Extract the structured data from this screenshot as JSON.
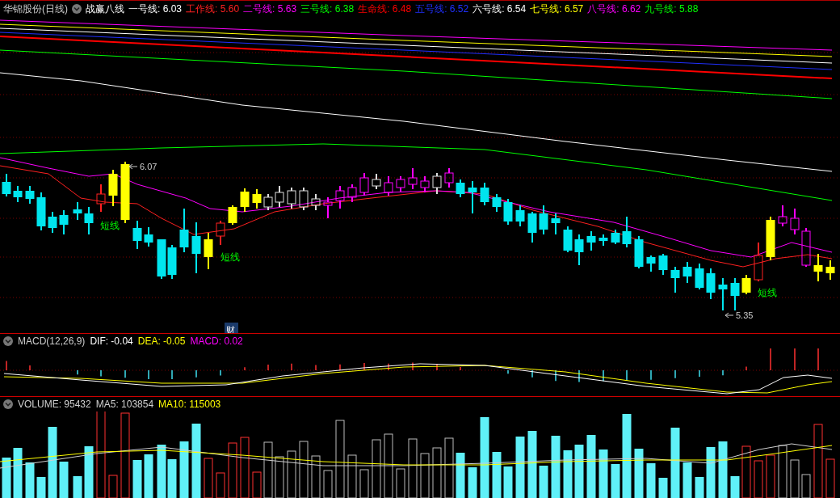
{
  "chart": {
    "title": "华锦股份(日线)",
    "indicator": "战赢八线",
    "lines": [
      {
        "text": "一号线: 6.03",
        "color": "#ffffff"
      },
      {
        "text": "工作线: 5.60",
        "color": "#ff2020"
      },
      {
        "text": "二号线: 5.63",
        "color": "#ff00ff"
      },
      {
        "text": "三号线: 6.38",
        "color": "#00ff00"
      },
      {
        "text": "生命线: 6.48",
        "color": "#ff0000"
      },
      {
        "text": "五号线: 6.52",
        "color": "#2030ff"
      },
      {
        "text": "六号线: 6.54",
        "color": "#ffffff"
      },
      {
        "text": "七号线: 6.57",
        "color": "#ffff00"
      },
      {
        "text": "八号线: 6.62",
        "color": "#ff00ff"
      },
      {
        "text": "九号线: 5.88",
        "color": "#00ff00"
      }
    ],
    "annotations": [
      {
        "kind": "high",
        "text": "6.07"
      },
      {
        "kind": "signal",
        "text": "短线"
      },
      {
        "kind": "signal",
        "text": "短线"
      },
      {
        "kind": "signal",
        "text": "短线"
      },
      {
        "kind": "low",
        "text": "5.35"
      },
      {
        "kind": "event",
        "text": "财"
      }
    ]
  },
  "macd": {
    "title": "MACD(12,26,9)",
    "values": [
      {
        "text": "DIF: -0.04",
        "color": "#ffffff"
      },
      {
        "text": "DEA: -0.05",
        "color": "#ffff00"
      },
      {
        "text": "MACD: 0.02",
        "color": "#ff00ff"
      }
    ]
  },
  "volume": {
    "values": [
      {
        "text": "VOLUME: 95432",
        "color": "#d0d0d0"
      },
      {
        "text": "MA5: 103854",
        "color": "#d0d0d0"
      },
      {
        "text": "MA10: 115003",
        "color": "#ffff00"
      }
    ]
  }
}
